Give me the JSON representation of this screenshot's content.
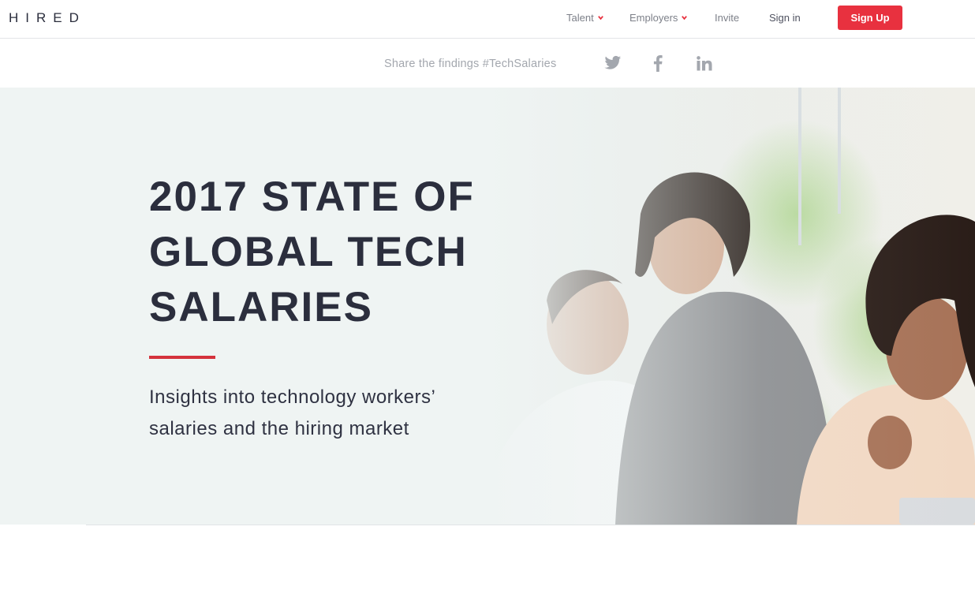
{
  "brand": {
    "logo": "HIRED"
  },
  "nav": {
    "items": [
      {
        "label": "Talent",
        "has_dropdown": true
      },
      {
        "label": "Employers",
        "has_dropdown": true
      },
      {
        "label": "Invite",
        "has_dropdown": false
      },
      {
        "label": "Sign in",
        "has_dropdown": false
      }
    ],
    "signup_label": "Sign Up"
  },
  "share": {
    "text": "Share the findings #TechSalaries",
    "icons": [
      "twitter-icon",
      "facebook-icon",
      "linkedin-icon"
    ]
  },
  "hero": {
    "title": "2017 STATE OF GLOBAL TECH SALARIES",
    "subtitle": "Insights into technology workers’ salaries and the hiring market"
  },
  "colors": {
    "accent": "#e8313f",
    "hero_bg": "#eff4f3",
    "text_dark": "#2b2e3d",
    "nav_text": "#7d8089",
    "share_icon": "#a3a7ae"
  }
}
